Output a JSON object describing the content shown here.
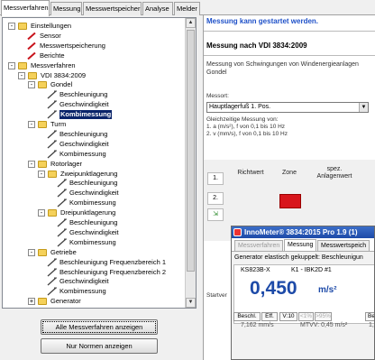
{
  "tabs": [
    "Messverfahren",
    "Messung",
    "Messwertspeicher",
    "Analyse",
    "Melder"
  ],
  "tree": [
    {
      "label": "Einstellungen",
      "icon": "folder",
      "expander": "-"
    },
    {
      "label": "Sensor",
      "icon": "red-pencil"
    },
    {
      "label": "Messwertspeicherung",
      "icon": "red-pencil"
    },
    {
      "label": "Berichte",
      "icon": "red-pencil"
    },
    {
      "label": "Messverfahren",
      "icon": "folder",
      "expander": "-"
    },
    {
      "label": "VDI 3834:2009",
      "icon": "folder",
      "expander": "-"
    },
    {
      "label": "Gondel",
      "icon": "folder",
      "expander": "-"
    },
    {
      "label": "Beschleunigung",
      "icon": "probe"
    },
    {
      "label": "Geschwindigkeit",
      "icon": "probe"
    },
    {
      "label": "Kombimessung",
      "icon": "probe",
      "selected": true
    },
    {
      "label": "Turm",
      "icon": "folder",
      "expander": "-"
    },
    {
      "label": "Beschleunigung",
      "icon": "probe"
    },
    {
      "label": "Geschwindigkeit",
      "icon": "probe"
    },
    {
      "label": "Kombimessung",
      "icon": "probe"
    },
    {
      "label": "Rotorlager",
      "icon": "folder",
      "expander": "-"
    },
    {
      "label": "Zweipunktlagerung",
      "icon": "folder",
      "expander": "-"
    },
    {
      "label": "Beschleunigung",
      "icon": "probe"
    },
    {
      "label": "Geschwindigkeit",
      "icon": "probe"
    },
    {
      "label": "Kombimessung",
      "icon": "probe"
    },
    {
      "label": "Dreipunktlagerung",
      "icon": "folder",
      "expander": "-"
    },
    {
      "label": "Beschleunigung",
      "icon": "probe"
    },
    {
      "label": "Geschwindigkeit",
      "icon": "probe"
    },
    {
      "label": "Kombimessung",
      "icon": "probe"
    },
    {
      "label": "Getriebe",
      "icon": "folder",
      "expander": "-"
    },
    {
      "label": "Beschleunigung Frequenzbereich 1",
      "icon": "probe"
    },
    {
      "label": "Beschleunigung Frequenzbereich 2",
      "icon": "probe"
    },
    {
      "label": "Geschwindigkeit",
      "icon": "probe"
    },
    {
      "label": "Kombimessung",
      "icon": "probe"
    },
    {
      "label": "Generator",
      "icon": "folder",
      "expander": "+"
    }
  ],
  "buttons": {
    "show_all": "Alle Messverfahren anzeigen",
    "norms_only": "Nur Normen anzeigen"
  },
  "right": {
    "status": "Messung kann gestartet werden.",
    "title": "Messung nach VDI 3834:2009",
    "description": "Messung von Schwingungen von Windenergieanlagen Gondel",
    "messort_label": "Messort:",
    "messort_value": "Hauptlagerfuß 1. Pos.",
    "simul_1": "Gleichzeitige Messung von:",
    "simul_2": "1. a (m/s²), f von 0,1 bis 10 Hz",
    "simul_3": "2. v (mm/s), f von 0,1 bis 10 Hz",
    "grid_row": "1.",
    "grid_col1": "Richtwert",
    "grid_col2": "Zone",
    "grid_col3": "spez. Anlagenwert",
    "grid_row2": "2.",
    "startvert": "Startver"
  },
  "inno": {
    "title": "InnoMeter® 3834:2015 Pro 1.9 (1)",
    "tabs": [
      "Messverfahren",
      "Messung",
      "Messwertspeich"
    ],
    "subtitle": "Generator elastisch gekuppelt: Beschleunigun",
    "sensor": "KS823B-X",
    "channel": "K1 - IBK2D #1",
    "value": "0,450",
    "unit": "m/s²",
    "btn_beschl": "Beschl.",
    "btn_eff": "Eff.",
    "btn_v10": "V:10",
    "btn_lt1": "<1%",
    "btn_gt95": ">95%",
    "btn_be": "Be",
    "footer_left": "7,162 mm/s",
    "footer_mid": "MTVV: 0,45 m/s²",
    "footer_right": "1,"
  }
}
